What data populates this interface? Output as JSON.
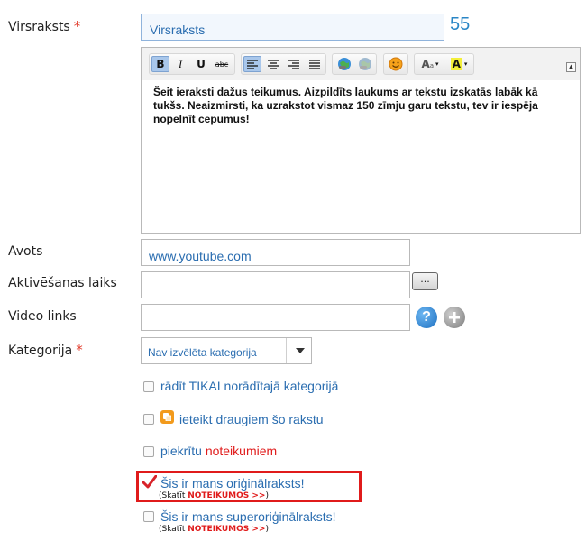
{
  "fields": {
    "title": {
      "label": "Virsraksts",
      "required_mark": "*",
      "value": "Virsraksts",
      "counter": "55"
    },
    "source": {
      "label": "Avots",
      "value": "www.youtube.com"
    },
    "activation": {
      "label": "Aktivēšanas laiks",
      "value": "",
      "button": "..."
    },
    "video": {
      "label": "Video links",
      "value": ""
    },
    "category": {
      "label": "Kategorija",
      "required_mark": "*",
      "selected": "Nav izvēlēta kategorija"
    }
  },
  "editor": {
    "text": "Šeit ieraksti dažus teikumus. Aizpildīts laukums ar tekstu izskatās labāk kā tukšs. Neaizmirsti, ka uzrakstot vismaz 150 zīmju garu tekstu, tev ir iespēja nopelnīt cepumus!",
    "toolbar": {
      "bold": "B",
      "italic": "I",
      "underline": "U",
      "strike": "abc",
      "font_size": "A",
      "highlight": "A"
    }
  },
  "options": {
    "only_marked": {
      "label": "rādīt TIKAI norādītajā kategorijā",
      "checked": false
    },
    "recommend": {
      "label": "ieteikt draugiem šo rakstu",
      "checked": false
    },
    "agree": {
      "label_prefix": "piekrītu ",
      "label_link": "noteikumiem",
      "checked": false
    },
    "original": {
      "label": "Šis ir mans oriģinālraksts!",
      "note_prefix": "(Skatīt ",
      "note_link": "NOTEIKUMOS >>",
      "note_suffix": ")",
      "checked": true
    },
    "super_original": {
      "label": "Šis ir mans superoriģinālraksts!",
      "note_prefix": "(Skatīt ",
      "note_link": "NOTEIKUMOS >>",
      "note_suffix": ")",
      "checked": false
    }
  },
  "colors": {
    "accent": "#2a6db0",
    "required": "#e23a2a",
    "highlight_box": "#e01b1b",
    "checkmark": "#d8232a"
  }
}
